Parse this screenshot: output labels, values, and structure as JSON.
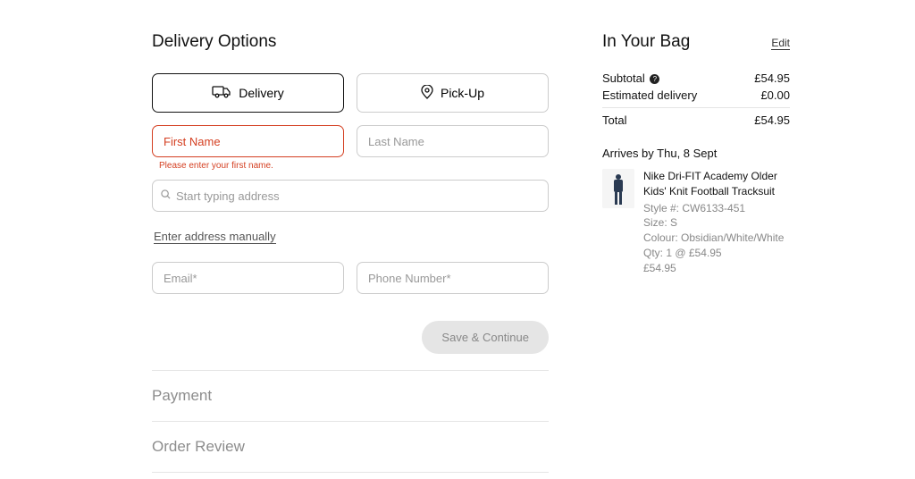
{
  "sections": {
    "delivery": "Delivery Options",
    "payment": "Payment",
    "review": "Order Review"
  },
  "tabs": {
    "delivery": "Delivery",
    "pickup": "Pick-Up"
  },
  "fields": {
    "first_name_placeholder": "First Name",
    "first_name_error": "Please enter your first name.",
    "last_name_placeholder": "Last Name",
    "address_placeholder": "Start typing address",
    "manual_link": "Enter address manually",
    "email_placeholder": "Email*",
    "phone_placeholder": "Phone Number*"
  },
  "buttons": {
    "save_continue": "Save & Continue"
  },
  "bag": {
    "title": "In Your Bag",
    "edit": "Edit",
    "subtotal_label": "Subtotal",
    "subtotal_value": "£54.95",
    "shipping_label": "Estimated delivery",
    "shipping_value": "£0.00",
    "total_label": "Total",
    "total_value": "£54.95",
    "arrives": "Arrives by Thu, 8 Sept"
  },
  "item": {
    "name": "Nike Dri-FIT Academy Older Kids' Knit Football Tracksuit",
    "style": "Style #: CW6133-451",
    "size": "Size: S",
    "colour": "Colour: Obsidian/White/White",
    "qty": "Qty: 1 @ £54.95",
    "price": "£54.95"
  }
}
